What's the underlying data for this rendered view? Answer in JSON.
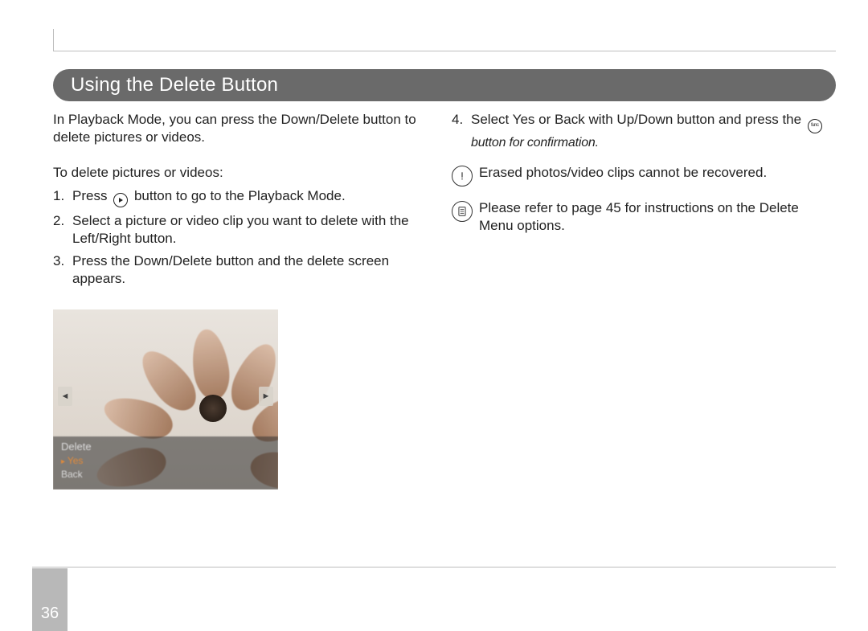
{
  "page": {
    "title": "Using the Delete Button",
    "number": "36"
  },
  "left": {
    "intro": "In Playback Mode, you can press the Down/Delete button to delete pictures or videos.",
    "subhead": "To delete pictures or videos:",
    "steps": [
      {
        "n": "1.",
        "before": "Press",
        "after": " button to go to the Playback Mode."
      },
      {
        "n": "2.",
        "text": "Select a picture or video clip you want to delete with the Left/Right button."
      },
      {
        "n": "3.",
        "text": "Press the Down/Delete button and the delete screen appears."
      }
    ],
    "lcd_menu": {
      "title": "Delete",
      "selected": "Yes",
      "other": "Back"
    }
  },
  "right": {
    "step4": {
      "n": "4.",
      "before": "Select Yes or Back with Up/Down button and press the",
      "italic": " button for confirmation."
    },
    "warning": "Erased photos/video clips cannot be recovered.",
    "note": "Please refer to page 45 for instructions on the Delete Menu options."
  }
}
